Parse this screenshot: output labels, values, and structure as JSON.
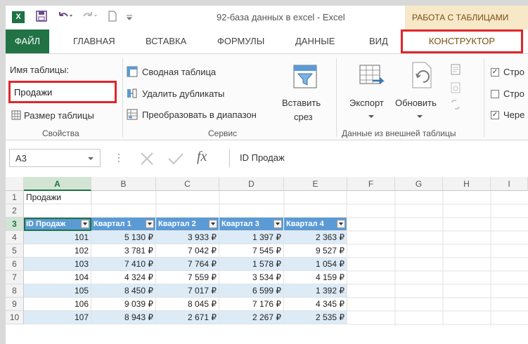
{
  "titlebar": {
    "app_icon": "X",
    "title": "92-база данных в excel - Excel",
    "contextual_label": "РАБОТА С ТАБЛИЦАМИ"
  },
  "tabs": [
    "ФАЙЛ",
    "ГЛАВНАЯ",
    "ВСТАВКА",
    "ФОРМУЛЫ",
    "ДАННЫЕ",
    "ВИД",
    "КОНСТРУКТОР"
  ],
  "ribbon": {
    "properties": {
      "name_label": "Имя таблицы:",
      "name_value": "Продажи",
      "resize_label": "Размер таблицы",
      "group_label": "Свойства"
    },
    "tools": {
      "pivot_label": "Сводная таблица",
      "dedupe_label": "Удалить дубликаты",
      "convert_label": "Преобразовать в диапазон",
      "slicer_line1": "Вставить",
      "slicer_line2": "срез",
      "group_label": "Сервис"
    },
    "external": {
      "export_label": "Экспорт",
      "refresh_label": "Обновить",
      "group_label": "Данные из внешней таблицы"
    },
    "style_options": [
      {
        "label": "Стро",
        "checked": true
      },
      {
        "label": "Стро",
        "checked": false
      },
      {
        "label": "Чере",
        "checked": true
      }
    ]
  },
  "formula_bar": {
    "cell_ref": "A3",
    "fx": "fx",
    "content": "ID Продаж"
  },
  "grid": {
    "columns": [
      "A",
      "B",
      "C",
      "D",
      "E",
      "F",
      "G",
      "H",
      "I"
    ],
    "rows": [
      "1",
      "2",
      "3",
      "4",
      "5",
      "6",
      "7",
      "8",
      "9",
      "10"
    ],
    "a1": "Продажи",
    "headers": [
      "ID Продаж",
      "Квартал 1",
      "Квартал 2",
      "Квартал 3",
      "Квартал 4"
    ],
    "data": [
      [
        "101",
        "5 130 ₽",
        "3 933 ₽",
        "1 397 ₽",
        "2 363 ₽"
      ],
      [
        "102",
        "3 781 ₽",
        "7 042 ₽",
        "7 545 ₽",
        "9 527 ₽"
      ],
      [
        "103",
        "7 410 ₽",
        "7 764 ₽",
        "1 578 ₽",
        "1 054 ₽"
      ],
      [
        "104",
        "4 324 ₽",
        "7 559 ₽",
        "3 534 ₽",
        "4 159 ₽"
      ],
      [
        "105",
        "8 450 ₽",
        "7 017 ₽",
        "6 599 ₽",
        "1 392 ₽"
      ],
      [
        "106",
        "9 039 ₽",
        "8 045 ₽",
        "7 176 ₽",
        "4 345 ₽"
      ],
      [
        "107",
        "8 943 ₽",
        "2 671 ₽",
        "2 267 ₽",
        "2 535 ₽"
      ]
    ]
  },
  "colors": {
    "excel_green": "#217346",
    "table_header": "#5b9bd5",
    "band": "#ddebf7",
    "highlight": "#e0262b"
  }
}
